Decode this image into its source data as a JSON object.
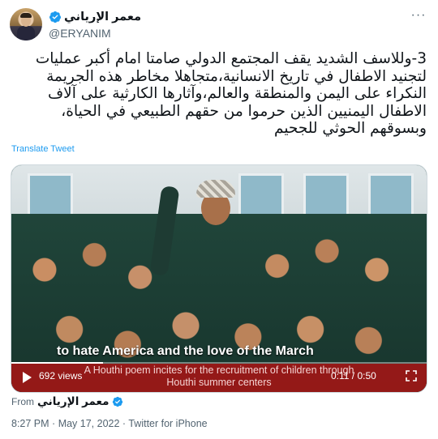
{
  "author": {
    "display_name": "معمر الإرياني",
    "handle": "@ERYANIM",
    "verified": true
  },
  "tweet": {
    "text": "3-وللاسف الشديد يقف المجتمع الدولي صامتا امام أكبر عمليات لتجنيد الاطفال في تاريخ الانسانية،متجاهلا مخاطر هذه الجريمة النكراء على اليمن والمنطقة والعالم،وآثارها الكارثية على آلاف الاطفال اليمنيين الذين حرموا من حقهم الطبيعي في الحياة، وبسوقهم الحوثي للجحيم",
    "translate_label": "Translate Tweet"
  },
  "media": {
    "subtitle": "to hate America and the love of the March",
    "caption_line1": "A Houthi poem incites for the recruitment of children through",
    "caption_line2": "Houthi summer centers",
    "views": "692 views",
    "time": "0:11 / 0:50",
    "progress": 0.22
  },
  "from": {
    "label": "From",
    "name": "معمر الإرياني"
  },
  "meta": {
    "time": "8:27 PM",
    "date": "May 17, 2022",
    "source": "Twitter for iPhone"
  },
  "colors": {
    "accent": "#1d9bf0",
    "secondary_text": "#536471",
    "caption_bg": "#aa1414"
  }
}
